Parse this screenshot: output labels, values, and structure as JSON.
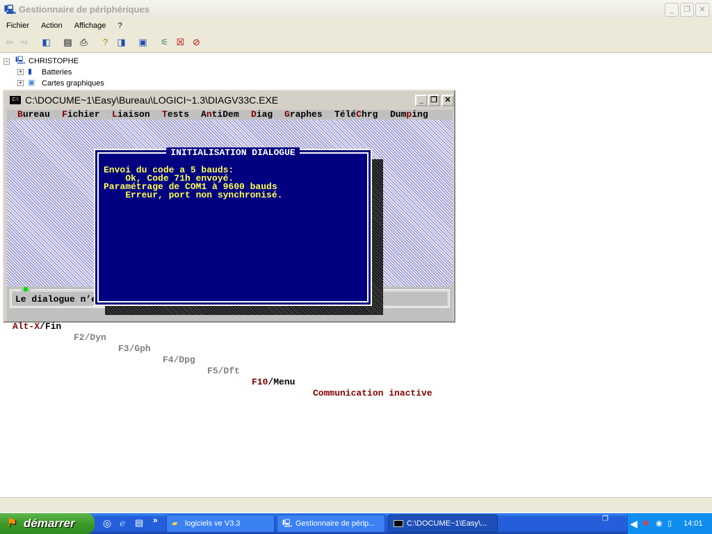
{
  "window": {
    "title": "Gestionnaire de périphériques",
    "menu": [
      "Fichier",
      "Action",
      "Affichage",
      "?"
    ]
  },
  "toolbar": {
    "icons": [
      "back-icon",
      "forward-icon",
      "show-hide-tree-icon",
      "properties-icon",
      "print-icon",
      "help-icon",
      "view-icon",
      "scan-hardware-icon",
      "update-driver-icon",
      "uninstall-icon",
      "disable-icon"
    ]
  },
  "tree": {
    "root": "CHRISTOPHE",
    "items": [
      "Batteries",
      "Cartes graphiques"
    ]
  },
  "console": {
    "title": "C:\\DOCUME~1\\Easy\\Bureau\\LOGICI~1.3\\DIAGV33C.EXE",
    "menu": [
      {
        "hot": "B",
        "rest": "ureau"
      },
      {
        "hot": "F",
        "rest": "ichier"
      },
      {
        "hot": "L",
        "rest": "iaison"
      },
      {
        "hot": "T",
        "rest": "ests"
      },
      {
        "pre": "A",
        "hot": "n",
        "rest": "tiDem"
      },
      {
        "hot": "D",
        "rest": "iag"
      },
      {
        "hot": "G",
        "rest": "raphes"
      },
      {
        "pre": "Télé",
        "hot": "C",
        "rest": "hrg"
      },
      {
        "pre": "Dum",
        "hot": "p",
        "rest": "ing"
      }
    ],
    "dialog": {
      "title": "INITIALISATION DIALOGUE",
      "lines": [
        "Envoi du code a 5 bauds:",
        "    Ok, Code 71h envoyé.",
        "Paramétrage de COM1 à 9600 bauds",
        "    Erreur, port non synchronisé."
      ]
    },
    "status": "Le dialogue n’est pas activé.",
    "fkeys": {
      "altx": "Alt-X",
      "fin": "/Fin",
      "f2": "F2/Dyn",
      "f3": "F3/Gph",
      "f4": "F4/Dpg",
      "f5": "F5/Dft",
      "f10": "F10",
      "menu": "/Menu",
      "comm": "Communication inactive"
    }
  },
  "taskbar": {
    "start": "démarrer",
    "tasks": [
      "logiciels ve V3.3",
      "Gestionnaire de périp...",
      "C:\\DOCUME~1\\Easy\\..."
    ],
    "clock": "14:01",
    "chevron": "»"
  }
}
